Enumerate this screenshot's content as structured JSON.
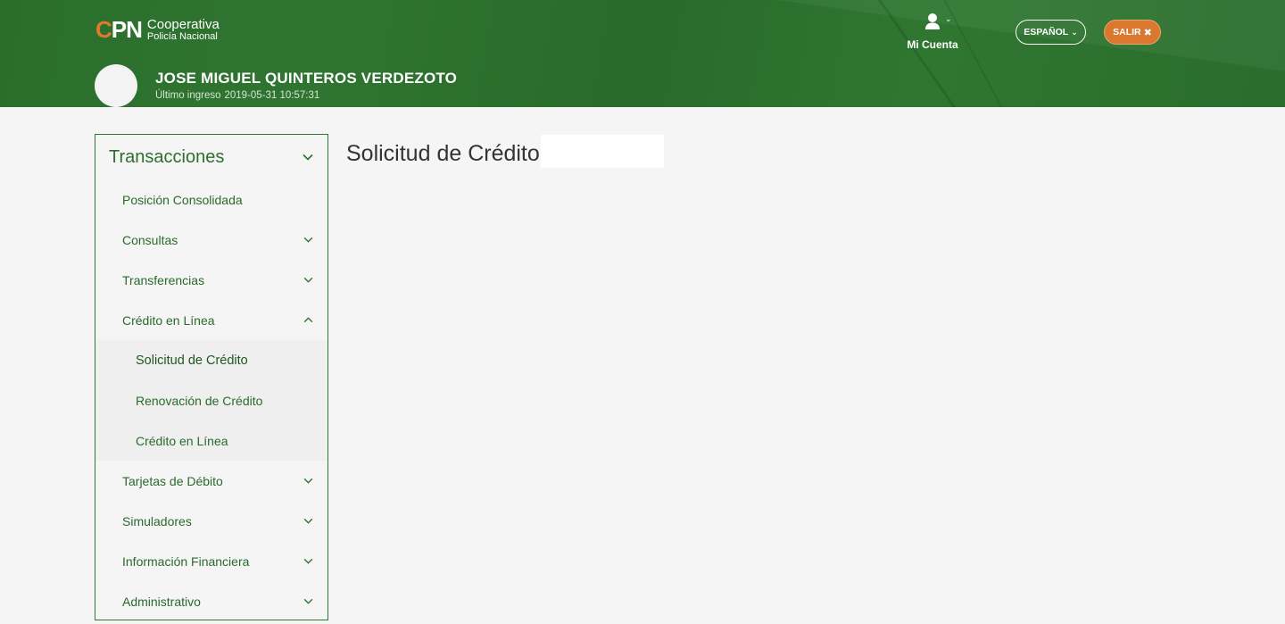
{
  "header": {
    "logo": {
      "mark": "CPN",
      "line1": "Cooperativa",
      "line2": "Policía Nacional"
    },
    "user_name": "JOSE MIGUEL QUINTEROS VERDEZOTO",
    "last_login_label": "Último ingreso",
    "last_login_value": "2019-05-31 10:57:31",
    "account_label": "Mi Cuenta",
    "language_label": "ESPAÑOL",
    "exit_label": "SALIR",
    "colors": {
      "header_green": "#2f7530",
      "exit_orange": "#d9782e"
    }
  },
  "sidebar": {
    "title": "Transacciones",
    "items": [
      {
        "label": "Posición Consolidada",
        "chevron": "none"
      },
      {
        "label": "Consultas",
        "chevron": "down"
      },
      {
        "label": "Transferencias",
        "chevron": "down"
      },
      {
        "label": "Crédito en Línea",
        "chevron": "up",
        "subitems": [
          {
            "label": "Solicitud de Crédito",
            "active": true
          },
          {
            "label": "Renovación de Crédito",
            "active": false
          },
          {
            "label": "Crédito en Línea",
            "active": false
          }
        ]
      },
      {
        "label": "Tarjetas de Débito",
        "chevron": "down"
      },
      {
        "label": "Simuladores",
        "chevron": "down"
      },
      {
        "label": "Información Financiera",
        "chevron": "down"
      },
      {
        "label": "Administrativo",
        "chevron": "down"
      }
    ]
  },
  "main": {
    "title": "Solicitud de Crédito"
  }
}
